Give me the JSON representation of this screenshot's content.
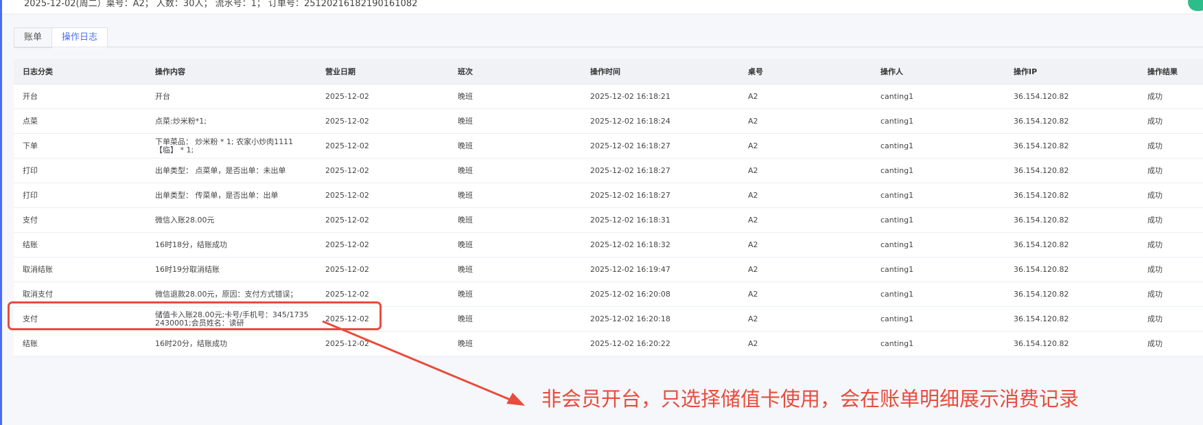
{
  "order": {
    "info_line": "2025-12-02(周二）桌号：A2；   人数：30人；     流水号：1；   订单号：251202161821901610​82"
  },
  "tabs": [
    {
      "label": "账单",
      "active": false
    },
    {
      "label": "操作日志",
      "active": true
    }
  ],
  "table": {
    "headers": [
      "日志分类",
      "操作内容",
      "营业日期",
      "班次",
      "操作时间",
      "桌号",
      "操作人",
      "操作IP",
      "操作结果"
    ],
    "rows": [
      [
        "开台",
        "开台",
        "2025-12-02",
        "晚班",
        "2025-12-02 16:18:21",
        "A2",
        "canting1",
        "36.154.120.82",
        "成功"
      ],
      [
        "点菜",
        "点菜:炒米粉*1;",
        "2025-12-02",
        "晚班",
        "2025-12-02 16:18:24",
        "A2",
        "canting1",
        "36.154.120.82",
        "成功"
      ],
      [
        "下单",
        "下单菜品：  炒米粉 * 1; 农家小炒肉1111【临】 * 1;",
        "2025-12-02",
        "晚班",
        "2025-12-02 16:18:27",
        "A2",
        "canting1",
        "36.154.120.82",
        "成功"
      ],
      [
        "打印",
        "出单类型：  点菜单，是否出单：未出单",
        "2025-12-02",
        "晚班",
        "2025-12-02 16:18:27",
        "A2",
        "canting1",
        "36.154.120.82",
        "成功"
      ],
      [
        "打印",
        "出单类型：  传菜单，是否出单：出单",
        "2025-12-02",
        "晚班",
        "2025-12-02 16:18:27",
        "A2",
        "canting1",
        "36.154.120.82",
        "成功"
      ],
      [
        "支付",
        "微信入账28.00元",
        "2025-12-02",
        "晚班",
        "2025-12-02 16:18:31",
        "A2",
        "canting1",
        "36.154.120.82",
        "成功"
      ],
      [
        "结账",
        "16时18分，结账成功",
        "2025-12-02",
        "晚班",
        "2025-12-02 16:18:32",
        "A2",
        "canting1",
        "36.154.120.82",
        "成功"
      ],
      [
        "取消结账",
        "16时19分取消结账",
        "2025-12-02",
        "晚班",
        "2025-12-02 16:19:47",
        "A2",
        "canting1",
        "36.154.120.82",
        "成功"
      ],
      [
        "取消支付",
        "微信退款28.00元，原因：支付方式错误；",
        "2025-12-02",
        "晚班",
        "2025-12-02 16:20:08",
        "A2",
        "canting1",
        "36.154.120.82",
        "成功"
      ],
      [
        "支付",
        "储值卡入账28.00元;卡号/手机号：345/17352430001;会员姓名：读研",
        "2025-12-02",
        "晚班",
        "2025-12-02 16:20:18",
        "A2",
        "canting1",
        "36.154.120.82",
        "成功"
      ],
      [
        "结账",
        "16时20分，结账成功",
        "2025-12-02",
        "晚班",
        "2025-12-02 16:20:22",
        "A2",
        "canting1",
        "36.154.120.82",
        "成功"
      ]
    ]
  },
  "annotation": {
    "text": "非会员开台，只选择储值卡使用，会在账单明细展示消费记录",
    "color": "#e94b3c"
  },
  "colors": {
    "accent": "#4a6cf7",
    "badge": "#2dbd8a"
  }
}
